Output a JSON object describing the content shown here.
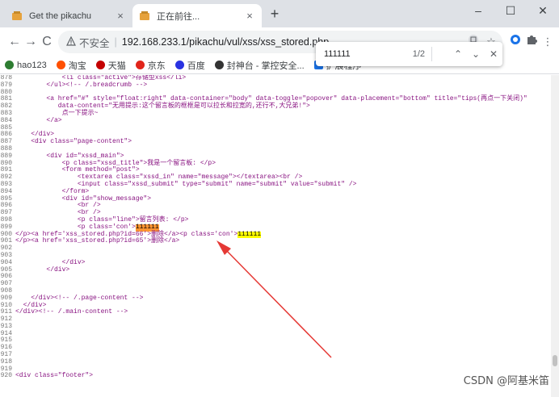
{
  "tabs": [
    {
      "title": "Get the pikachu",
      "close": "×"
    },
    {
      "title": "正在前往...",
      "close": "×"
    }
  ],
  "newtab": "+",
  "window": {
    "minimize": "–",
    "maximize": "☐",
    "close": "✕"
  },
  "toolbar": {
    "back": "←",
    "forward": "→",
    "reload": "C",
    "insecure_label": "不安全",
    "sep": "|",
    "url": "192.168.233.1/pikachu/vul/xss/xss_stored.php"
  },
  "bookmarks": [
    {
      "label": "hao123",
      "color": "#2e7d32"
    },
    {
      "label": "淘宝",
      "color": "#ff5000"
    },
    {
      "label": "天猫",
      "color": "#c40000"
    },
    {
      "label": "京东",
      "color": "#e1251b"
    },
    {
      "label": "百度",
      "color": "#2932e1"
    },
    {
      "label": "封神台 - 掌控安全...",
      "color": "#333333"
    },
    {
      "label": "扩展程序",
      "color": "#1a73e8"
    }
  ],
  "findbar": {
    "query": "111111",
    "count": "1/2",
    "prev": "⌃",
    "next": "⌄",
    "close": "✕"
  },
  "source_lines": [
    {
      "n": "878",
      "code": "            <li class=\"active\">存储型xss</li>"
    },
    {
      "n": "879",
      "code": "        </ul><!-- /.breadcrumb -->"
    },
    {
      "n": "880",
      "code": ""
    },
    {
      "n": "881",
      "code": "        <a href=\"#\" style=\"float:right\" data-container=\"body\" data-toggle=\"popover\" data-placement=\"bottom\" title=\"tips(再点一下关闭)\""
    },
    {
      "n": "882",
      "code": "           data-content=\"无用提示:这个留言板的框框是可以拉长和拉宽的,还行不,大兄弟!\">"
    },
    {
      "n": "883",
      "code": "            点一下提示~"
    },
    {
      "n": "884",
      "code": "        </a>"
    },
    {
      "n": "885",
      "code": ""
    },
    {
      "n": "886",
      "code": "    </div>"
    },
    {
      "n": "887",
      "code": "    <div class=\"page-content\">"
    },
    {
      "n": "888",
      "code": ""
    },
    {
      "n": "889",
      "code": "        <div id=\"xssd_main\">"
    },
    {
      "n": "890",
      "code": "            <p class=\"xssd_title\">我是一个留言板: </p>"
    },
    {
      "n": "891",
      "code": "            <form method=\"post\">"
    },
    {
      "n": "892",
      "code": "                <textarea class=\"xssd_in\" name=\"message\"></textarea><br />"
    },
    {
      "n": "893",
      "code": "                <input class=\"xssd_submit\" type=\"submit\" name=\"submit\" value=\"submit\" />"
    },
    {
      "n": "894",
      "code": "            </form>"
    },
    {
      "n": "895",
      "code": "            <div id=\"show_message\">"
    },
    {
      "n": "896",
      "code": "                <br />"
    },
    {
      "n": "897",
      "code": "                <br />"
    },
    {
      "n": "898",
      "code": "                <p class=\"line\">留言列表: </p>"
    },
    {
      "n": "899",
      "code": "                <p class='con'>",
      "hl": "111111",
      "hl_kind": "active",
      "after": ""
    },
    {
      "n": "900",
      "code": "</p><a href='xss_stored.php?id=66'>删除</a><p class='con'>",
      "hl": "111111",
      "hl_kind": "normal",
      "after": ""
    },
    {
      "n": "901",
      "code": "</p><a href='xss_stored.php?id=65'>删除</a>"
    },
    {
      "n": "902",
      "code": ""
    },
    {
      "n": "903",
      "code": ""
    },
    {
      "n": "904",
      "code": "            </div>"
    },
    {
      "n": "905",
      "code": "        </div>"
    },
    {
      "n": "906",
      "code": ""
    },
    {
      "n": "907",
      "code": ""
    },
    {
      "n": "908",
      "code": ""
    },
    {
      "n": "909",
      "code": "    </div><!-- /.page-content -->"
    },
    {
      "n": "910",
      "code": "  </div>"
    },
    {
      "n": "911",
      "code": "</div><!-- /.main-content -->"
    },
    {
      "n": "912",
      "code": ""
    },
    {
      "n": "913",
      "code": ""
    },
    {
      "n": "914",
      "code": ""
    },
    {
      "n": "915",
      "code": ""
    },
    {
      "n": "916",
      "code": ""
    },
    {
      "n": "917",
      "code": ""
    },
    {
      "n": "918",
      "code": ""
    },
    {
      "n": "919",
      "code": ""
    },
    {
      "n": "920",
      "code": "<div class=\"footer\">"
    }
  ],
  "watermark": "CSDN @阿基米笛",
  "colors": {
    "highlight": "#ffff00",
    "highlight_active": "#ff9632",
    "arrow": "#e53935",
    "tag": "#881280"
  }
}
